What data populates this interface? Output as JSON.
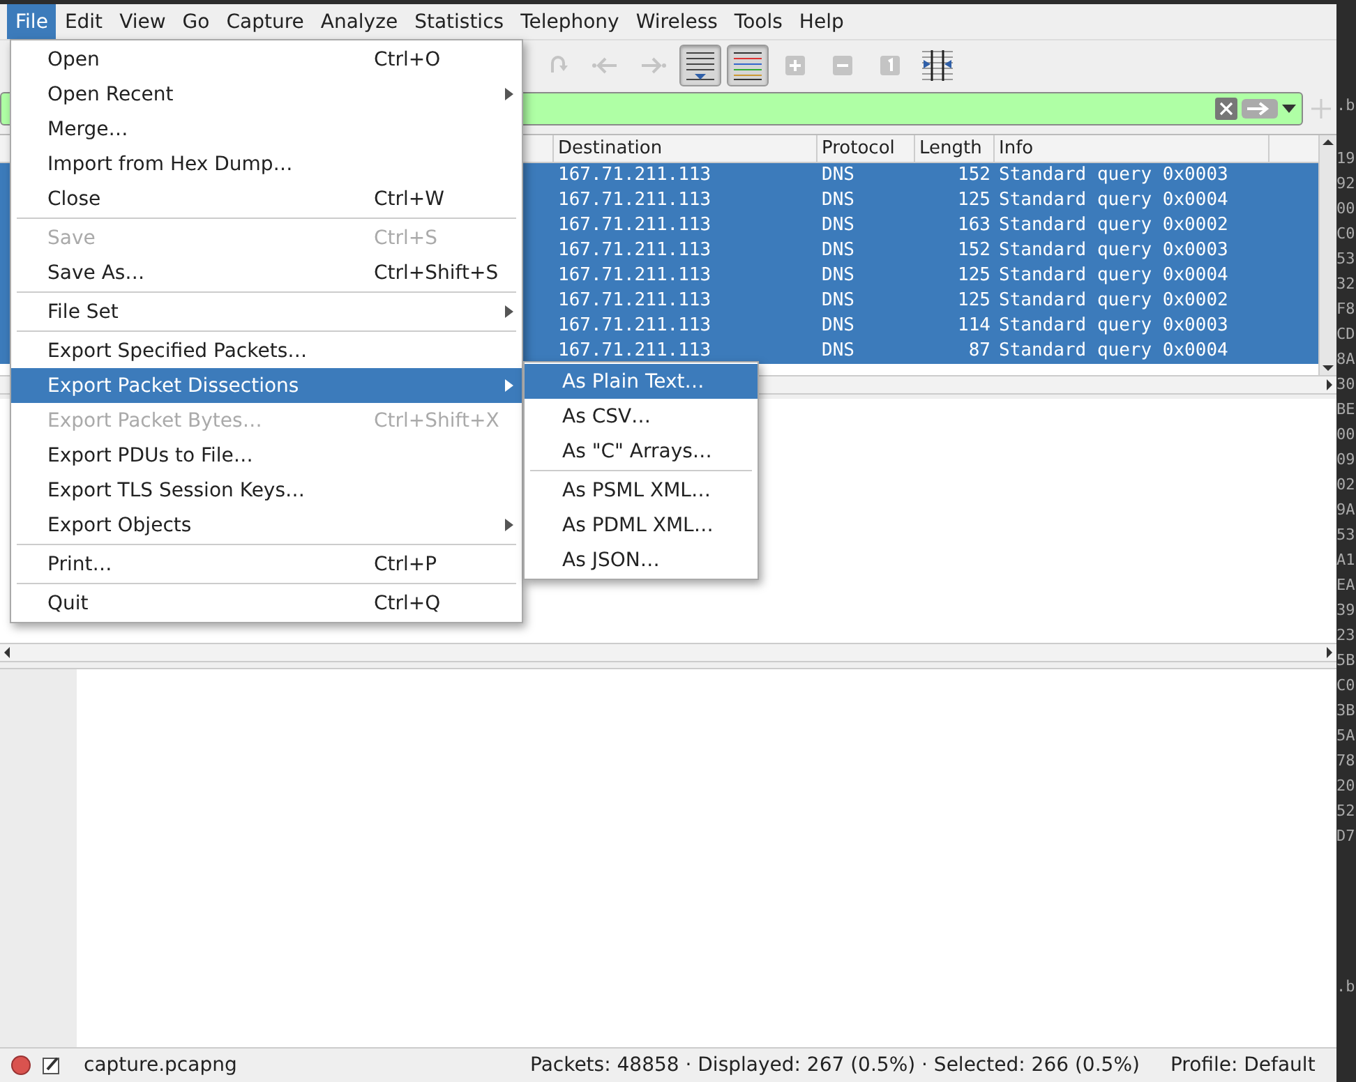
{
  "menubar": [
    {
      "label": "File",
      "selected": true
    },
    {
      "label": "Edit",
      "selected": false
    },
    {
      "label": "View",
      "selected": false
    },
    {
      "label": "Go",
      "selected": false
    },
    {
      "label": "Capture",
      "selected": false
    },
    {
      "label": "Analyze",
      "selected": false
    },
    {
      "label": "Statistics",
      "selected": false
    },
    {
      "label": "Telephony",
      "selected": false
    },
    {
      "label": "Wireless",
      "selected": false
    },
    {
      "label": "Tools",
      "selected": false
    },
    {
      "label": "Help",
      "selected": false
    }
  ],
  "toolbar": [
    {
      "kind": "reload",
      "disabled": true,
      "pressed": false
    },
    {
      "kind": "back",
      "disabled": true,
      "pressed": false
    },
    {
      "kind": "forward",
      "disabled": true,
      "pressed": false
    },
    {
      "kind": "autoscroll",
      "disabled": false,
      "pressed": true
    },
    {
      "kind": "colorize",
      "disabled": false,
      "pressed": true
    },
    {
      "kind": "zoom-in",
      "disabled": true,
      "pressed": false
    },
    {
      "kind": "zoom-out",
      "disabled": true,
      "pressed": false
    },
    {
      "kind": "zoom-reset",
      "disabled": true,
      "pressed": false
    },
    {
      "kind": "resize-columns",
      "disabled": false,
      "pressed": false
    }
  ],
  "packet_list": {
    "columns": [
      "Destination",
      "Protocol",
      "Length",
      "Info"
    ],
    "rows": [
      {
        "destination": "167.71.211.113",
        "protocol": "DNS",
        "length": "152",
        "info": "Standard query 0x0003",
        "selected": true
      },
      {
        "destination": "167.71.211.113",
        "protocol": "DNS",
        "length": "125",
        "info": "Standard query 0x0004",
        "selected": true
      },
      {
        "destination": "167.71.211.113",
        "protocol": "DNS",
        "length": "163",
        "info": "Standard query 0x0002",
        "selected": true
      },
      {
        "destination": "167.71.211.113",
        "protocol": "DNS",
        "length": "152",
        "info": "Standard query 0x0003",
        "selected": true
      },
      {
        "destination": "167.71.211.113",
        "protocol": "DNS",
        "length": "125",
        "info": "Standard query 0x0004",
        "selected": true
      },
      {
        "destination": "167.71.211.113",
        "protocol": "DNS",
        "length": "125",
        "info": "Standard query 0x0002",
        "selected": true
      },
      {
        "destination": "167.71.211.113",
        "protocol": "DNS",
        "length": "114",
        "info": "Standard query 0x0003",
        "selected": true
      },
      {
        "destination": "167.71.211.113",
        "protocol": "DNS",
        "length": "87",
        "info": "Standard query 0x0004",
        "selected": true
      }
    ]
  },
  "file_menu": [
    {
      "kind": "item",
      "label": "Open",
      "shortcut": "Ctrl+O",
      "disabled": false,
      "submenu": false,
      "selected": false
    },
    {
      "kind": "item",
      "label": "Open Recent",
      "disabled": false,
      "submenu": true,
      "selected": false
    },
    {
      "kind": "item",
      "label": "Merge…",
      "disabled": false,
      "submenu": false,
      "selected": false
    },
    {
      "kind": "item",
      "label": "Import from Hex Dump…",
      "disabled": false,
      "submenu": false,
      "selected": false
    },
    {
      "kind": "item",
      "label": "Close",
      "shortcut": "Ctrl+W",
      "disabled": false,
      "submenu": false,
      "selected": false
    },
    {
      "kind": "separator"
    },
    {
      "kind": "item",
      "label": "Save",
      "shortcut": "Ctrl+S",
      "disabled": true,
      "submenu": false,
      "selected": false
    },
    {
      "kind": "item",
      "label": "Save As…",
      "shortcut": "Ctrl+Shift+S",
      "disabled": false,
      "submenu": false,
      "selected": false
    },
    {
      "kind": "separator"
    },
    {
      "kind": "item",
      "label": "File Set",
      "disabled": false,
      "submenu": true,
      "selected": false
    },
    {
      "kind": "separator"
    },
    {
      "kind": "item",
      "label": "Export Specified Packets…",
      "disabled": false,
      "submenu": false,
      "selected": false
    },
    {
      "kind": "item",
      "label": "Export Packet Dissections",
      "disabled": false,
      "submenu": true,
      "selected": true
    },
    {
      "kind": "item",
      "label": "Export Packet Bytes…",
      "shortcut": "Ctrl+Shift+X",
      "disabled": true,
      "submenu": false,
      "selected": false
    },
    {
      "kind": "item",
      "label": "Export PDUs to File…",
      "disabled": false,
      "submenu": false,
      "selected": false
    },
    {
      "kind": "item",
      "label": "Export TLS Session Keys…",
      "disabled": false,
      "submenu": false,
      "selected": false
    },
    {
      "kind": "item",
      "label": "Export Objects",
      "disabled": false,
      "submenu": true,
      "selected": false
    },
    {
      "kind": "separator"
    },
    {
      "kind": "item",
      "label": "Print…",
      "shortcut": "Ctrl+P",
      "disabled": false,
      "submenu": false,
      "selected": false
    },
    {
      "kind": "separator"
    },
    {
      "kind": "item",
      "label": "Quit",
      "shortcut": "Ctrl+Q",
      "disabled": false,
      "submenu": false,
      "selected": false
    }
  ],
  "dissections_submenu": [
    {
      "kind": "item",
      "label": "As Plain Text…",
      "selected": true
    },
    {
      "kind": "item",
      "label": "As CSV…",
      "selected": false
    },
    {
      "kind": "item",
      "label": "As \"C\" Arrays…",
      "selected": false
    },
    {
      "kind": "separator"
    },
    {
      "kind": "item",
      "label": "As PSML XML…",
      "selected": false
    },
    {
      "kind": "item",
      "label": "As PDML XML…",
      "selected": false
    },
    {
      "kind": "item",
      "label": "As JSON…",
      "selected": false
    }
  ],
  "status_bar": {
    "file": "capture.pcapng",
    "stats": "Packets: 48858 · Displayed: 267 (0.5%) · Selected: 266 (0.5%)",
    "profile": "Profile: Default"
  },
  "background_terminal": {
    "top": ".b",
    "lines": [
      "19",
      "92",
      "00",
      "C0",
      "53",
      "32",
      "F8",
      "CD",
      "8A",
      "30",
      "BE",
      "00",
      "09",
      "02",
      "9A",
      "53",
      "A1",
      "EA",
      "39",
      "23",
      "5B",
      "C0",
      "3B",
      "5A",
      "78",
      "20",
      "52",
      "D7"
    ],
    "bottom": ".b"
  }
}
